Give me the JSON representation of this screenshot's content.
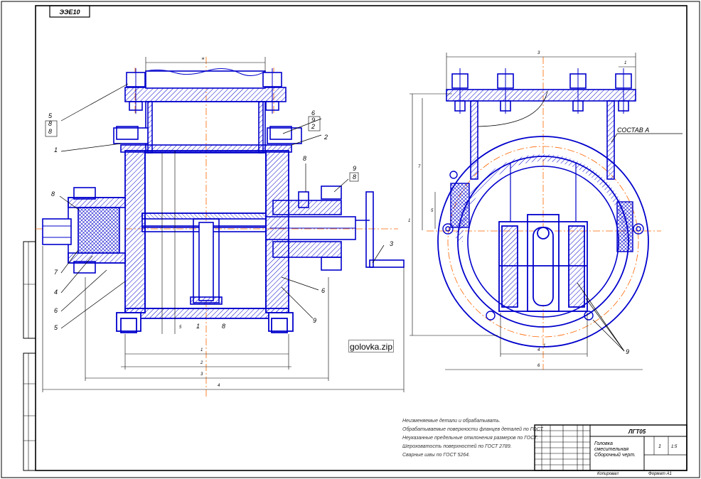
{
  "stamp_code": "ЭЭЕ10",
  "file_badge": "golovka.zip",
  "colors": {
    "outline": "#0000cc",
    "axis": "#ff6600",
    "frame": "#000000",
    "hatch": "#0000cc",
    "paper": "#ffffff"
  },
  "left_view": {
    "callouts": [
      "1",
      "2",
      "3",
      "4",
      "5",
      "6",
      "7",
      "8",
      "9",
      "1",
      "6",
      "8",
      "8",
      "9",
      "2",
      "6"
    ],
    "stack_left": [
      "5",
      "8",
      "8"
    ],
    "stack_right": [
      "6",
      "9",
      "2"
    ],
    "stack_small": [
      "9",
      "8"
    ],
    "dims": [
      "н",
      "1",
      "2",
      "3",
      "4",
      "5"
    ]
  },
  "right_view": {
    "section_label": "СОСТАВ А",
    "callouts": [
      "9"
    ],
    "dims": [
      "3",
      "1",
      "7",
      "1",
      "5",
      "4",
      "6",
      "1"
    ]
  },
  "notes": [
    "Неизменяемые детали и обрабатывать.",
    "Обрабатываемые поверхности фланцев деталей по ГОСТ.",
    "Неуказанные предельные отклонения размеров по ГОСТ.",
    "Шероховатость поверхностей по ГОСТ 2789.",
    "Сварные швы по ГОСТ 5264."
  ],
  "title_block": {
    "designation": "ЛГТ05",
    "title_line1": "Головка",
    "title_line2": "смесительная",
    "title_line3": "Сборочный черт.",
    "sheet": "1",
    "scale": "1:5",
    "bottom_left": "Копировал",
    "bottom_right": "Формат А1"
  }
}
